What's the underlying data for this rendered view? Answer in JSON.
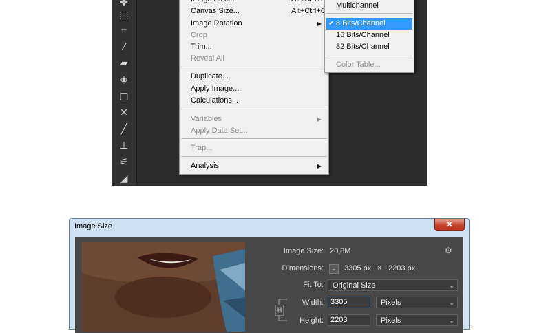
{
  "menu": {
    "items": [
      {
        "label": "Image Size...",
        "shortcut": "Alt+Ctrl+I",
        "disabled": false
      },
      {
        "label": "Canvas Size...",
        "shortcut": "Alt+Ctrl+C",
        "disabled": false
      },
      {
        "label": "Image Rotation",
        "shortcut": "",
        "disabled": false,
        "submenu": true
      },
      {
        "label": "Crop",
        "shortcut": "",
        "disabled": true
      },
      {
        "label": "Trim...",
        "shortcut": "",
        "disabled": false
      },
      {
        "label": "Reveal All",
        "shortcut": "",
        "disabled": true
      },
      {
        "label": "Duplicate...",
        "shortcut": "",
        "disabled": false
      },
      {
        "label": "Apply Image...",
        "shortcut": "",
        "disabled": false
      },
      {
        "label": "Calculations...",
        "shortcut": "",
        "disabled": false
      },
      {
        "label": "Variables",
        "shortcut": "",
        "disabled": true,
        "submenu": true
      },
      {
        "label": "Apply Data Set...",
        "shortcut": "",
        "disabled": true
      },
      {
        "label": "Trap...",
        "shortcut": "",
        "disabled": true
      },
      {
        "label": "Analysis",
        "shortcut": "",
        "disabled": false,
        "submenu": true
      }
    ]
  },
  "submenu": {
    "items": [
      {
        "label": "Multichannel",
        "selected": false,
        "disabled": false
      },
      {
        "label": "8 Bits/Channel",
        "selected": true,
        "disabled": false
      },
      {
        "label": "16 Bits/Channel",
        "selected": false,
        "disabled": false
      },
      {
        "label": "32 Bits/Channel",
        "selected": false,
        "disabled": false
      },
      {
        "label": "Color Table...",
        "selected": false,
        "disabled": true
      }
    ],
    "check_glyph": "✔"
  },
  "toolbar": {
    "icons": [
      "move-tool-icon",
      "quick-selection-icon",
      "crop-icon",
      "eyedropper-icon",
      "healing-brush-icon",
      "patch-icon",
      "frame-icon",
      "content-aware-move-icon",
      "brush-icon",
      "clone-stamp-icon",
      "history-brush-icon",
      "eraser-icon"
    ]
  },
  "dialog": {
    "title": "Image Size",
    "close_label": "✕",
    "image_size_label": "Image Size:",
    "image_size_value": "20,8M",
    "dimensions_label": "Dimensions:",
    "dimensions_width": "3305 px",
    "dimensions_times": "×",
    "dimensions_height": "2203 px",
    "fit_to_label": "Fit To:",
    "fit_to_value": "Original Size",
    "width_label": "Width:",
    "width_value": "3305",
    "width_unit": "Pixels",
    "height_label": "Height:",
    "height_value": "2203",
    "height_unit": "Pixels"
  },
  "colors": {
    "menu_bg": "#f0f0f0",
    "selection": "#3399ff",
    "ps_bg": "#2b2b2b",
    "dialog_body": "#474747",
    "dialog_frame": "#cfe0f1"
  }
}
